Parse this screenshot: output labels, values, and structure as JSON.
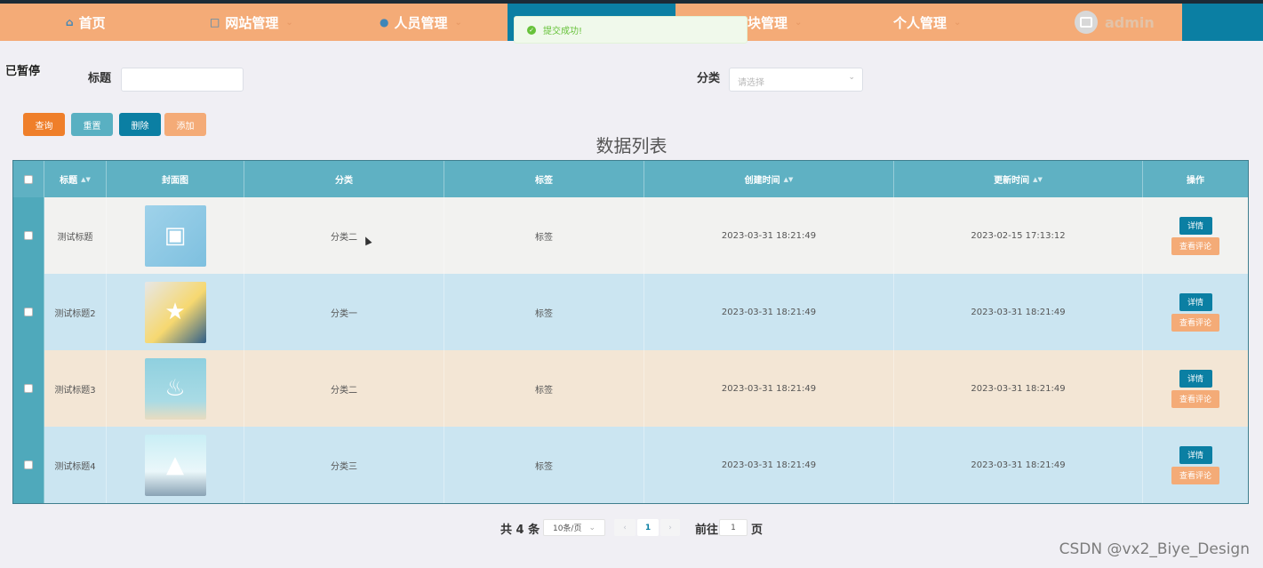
{
  "nav": {
    "items": [
      {
        "label": "首页",
        "icon": "home-icon"
      },
      {
        "label": "网站管理",
        "icon": "monitor-icon"
      },
      {
        "label": "人员管理",
        "icon": "user-icon"
      },
      {
        "label": "块管理",
        "icon": ""
      },
      {
        "label": "个人管理",
        "icon": ""
      }
    ],
    "admin_name": "admin"
  },
  "toast": {
    "message": "提交成功!"
  },
  "overlay_text": "已暂停",
  "search": {
    "title_label": "标题",
    "title_value": "",
    "category_label": "分类",
    "category_placeholder": "请选择"
  },
  "buttons": {
    "query": "查询",
    "reset": "重置",
    "delete": "删除",
    "add": "添加"
  },
  "table": {
    "heading": "数据列表",
    "columns": [
      "标题",
      "封面图",
      "分类",
      "标签",
      "创建时间",
      "更新时间",
      "操作"
    ],
    "rows": [
      {
        "title": "测试标题",
        "category": "分类二",
        "tag": "标签",
        "created": "2023-03-31 18:21:49",
        "updated": "2023-02-15 17:13:12"
      },
      {
        "title": "测试标题2",
        "category": "分类一",
        "tag": "标签",
        "created": "2023-03-31 18:21:49",
        "updated": "2023-03-31 18:21:49"
      },
      {
        "title": "测试标题3",
        "category": "分类二",
        "tag": "标签",
        "created": "2023-03-31 18:21:49",
        "updated": "2023-03-31 18:21:49"
      },
      {
        "title": "测试标题4",
        "category": "分类三",
        "tag": "标签",
        "created": "2023-03-31 18:21:49",
        "updated": "2023-03-31 18:21:49"
      }
    ],
    "row_actions": {
      "detail": "详情",
      "comments": "查看评论"
    }
  },
  "pager": {
    "total": "共 4 条",
    "page_size": "10条/页",
    "current": "1",
    "goto_prefix": "前往",
    "goto_value": "1",
    "goto_suffix": "页"
  },
  "watermark": "CSDN @vx2_Biye_Design",
  "colors": {
    "nav_orange": "#f4ab77",
    "nav_teal": "#0b7fa3",
    "header_teal": "#5fb1c3",
    "query_btn": "#ef7f2a",
    "reset_btn": "#59b0c2"
  }
}
